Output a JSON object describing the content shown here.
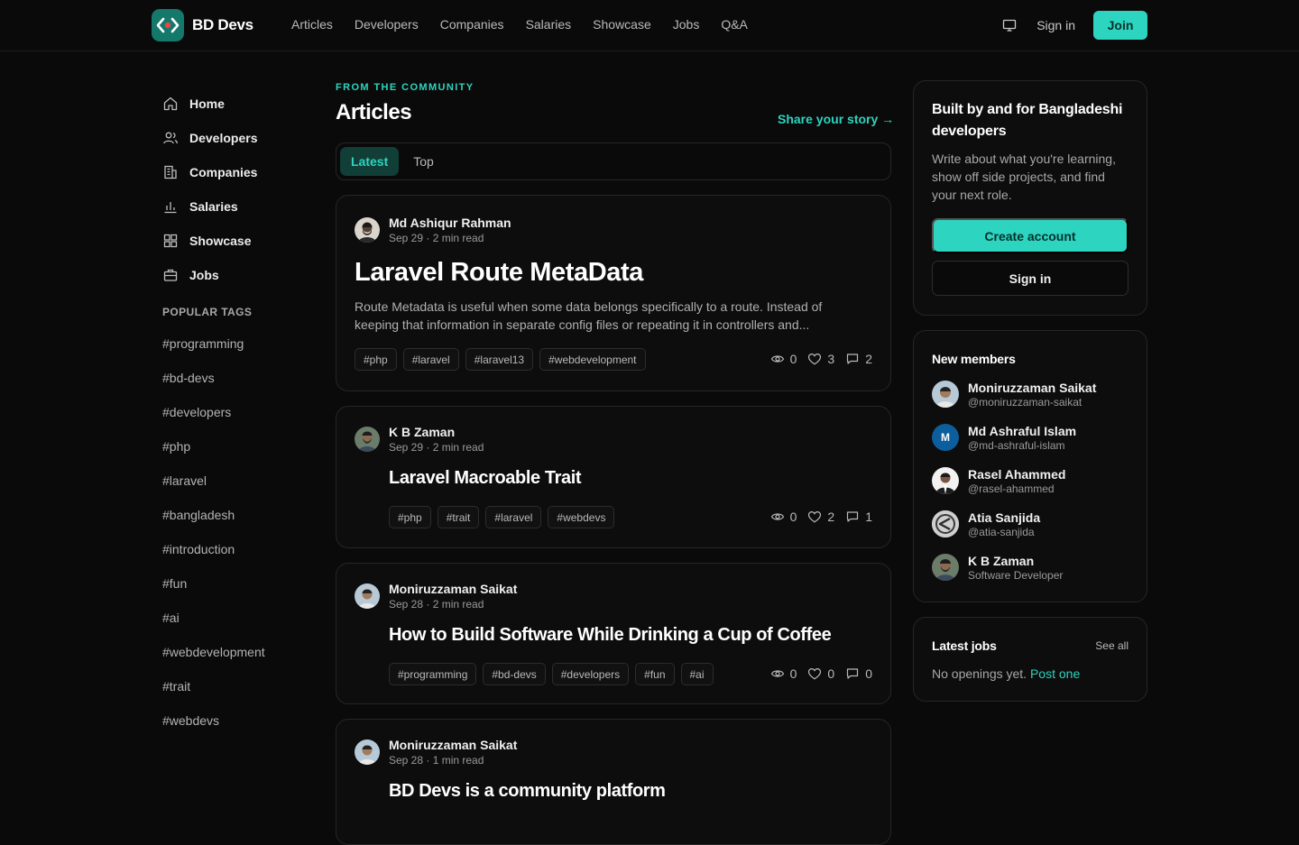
{
  "header": {
    "brand": "BD Devs",
    "nav": [
      "Articles",
      "Developers",
      "Companies",
      "Salaries",
      "Showcase",
      "Jobs",
      "Q&A"
    ],
    "sign_in": "Sign in",
    "join": "Join"
  },
  "sidebar": {
    "items": [
      {
        "label": "Home",
        "icon": "home-icon"
      },
      {
        "label": "Developers",
        "icon": "users-icon"
      },
      {
        "label": "Companies",
        "icon": "building-icon"
      },
      {
        "label": "Salaries",
        "icon": "bar-chart-icon"
      },
      {
        "label": "Showcase",
        "icon": "grid-icon"
      },
      {
        "label": "Jobs",
        "icon": "briefcase-icon"
      }
    ],
    "tags_title": "POPULAR TAGS",
    "tags": [
      "#programming",
      "#bd-devs",
      "#developers",
      "#php",
      "#laravel",
      "#bangladesh",
      "#introduction",
      "#fun",
      "#ai",
      "#webdevelopment",
      "#trait",
      "#webdevs"
    ]
  },
  "main": {
    "eyebrow": "FROM THE COMMUNITY",
    "title": "Articles",
    "share": "Share your story →",
    "tabs": [
      "Latest",
      "Top"
    ],
    "articles": [
      {
        "author": "Md Ashiqur Rahman",
        "meta": "Sep 29 · 2 min read",
        "title": "Laravel Route MetaData",
        "excerpt": "Route Metadata is useful when some data belongs specifically to a route. Instead of keeping that information in separate config files or repeating it in controllers and...",
        "tags": [
          "#php",
          "#laravel",
          "#laravel13",
          "#webdevelopment"
        ],
        "views": "0",
        "likes": "3",
        "comments": "2"
      },
      {
        "author": "K B Zaman",
        "meta": "Sep 29 · 2 min read",
        "title": "Laravel Macroable Trait",
        "tags": [
          "#php",
          "#trait",
          "#laravel",
          "#webdevs"
        ],
        "views": "0",
        "likes": "2",
        "comments": "1"
      },
      {
        "author": "Moniruzzaman Saikat",
        "meta": "Sep 28 · 2 min read",
        "title": "How to Build Software While Drinking a Cup of Coffee",
        "tags": [
          "#programming",
          "#bd-devs",
          "#developers",
          "#fun",
          "#ai"
        ],
        "views": "0",
        "likes": "0",
        "comments": "0"
      },
      {
        "author": "Moniruzzaman Saikat",
        "meta": "Sep 28 · 1 min read",
        "title": "BD Devs is a community platform"
      }
    ]
  },
  "right": {
    "cta": {
      "title": "Built by and for Bangladeshi developers",
      "text": "Write about what you're learning, show off side projects, and find your next role.",
      "create": "Create account",
      "signin": "Sign in"
    },
    "members": {
      "title": "New members",
      "list": [
        {
          "name": "Moniruzzaman Saikat",
          "handle": "@moniruzzaman-saikat"
        },
        {
          "name": "Md Ashraful Islam",
          "handle": "@md-ashraful-islam",
          "initial": "M"
        },
        {
          "name": "Rasel Ahammed",
          "handle": "@rasel-ahammed"
        },
        {
          "name": "Atia Sanjida",
          "handle": "@atia-sanjida"
        },
        {
          "name": "K B Zaman",
          "handle": "Software Developer"
        }
      ]
    },
    "jobs": {
      "title": "Latest jobs",
      "see_all": "See all",
      "empty": "No openings yet.",
      "post": "Post one"
    }
  },
  "colors": {
    "accent": "#2dd4bf",
    "background": "#0a0a0a",
    "card": "#0d0d0d",
    "border": "#262626"
  }
}
